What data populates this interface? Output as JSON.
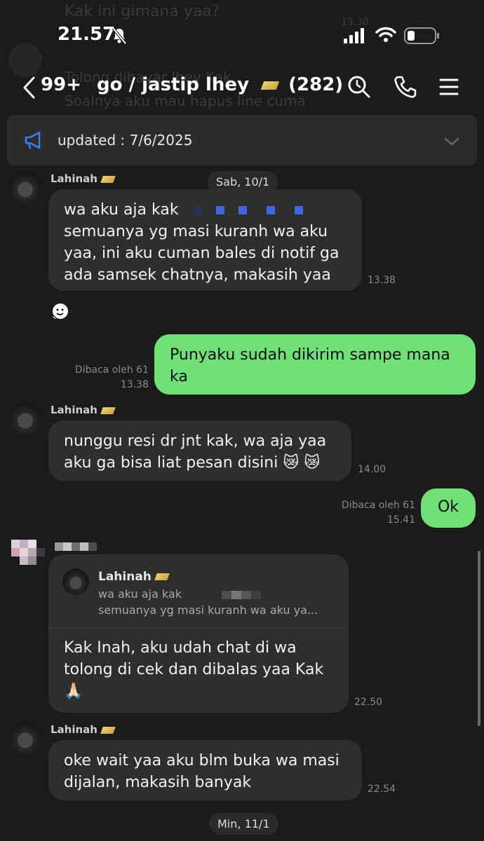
{
  "status": {
    "time": "21.57"
  },
  "nav": {
    "unread": "99+",
    "title": "go / jastip lhey",
    "members": "(282)"
  },
  "ghost": {
    "line1": "Kak ini gimana yaa?",
    "time1": "13.30",
    "line2": "Tolong dibayar lhey Kak",
    "line3": "Soalnya aku mau hapus line cuma"
  },
  "announcement": {
    "text": "updated : 7/6/2025"
  },
  "dates": {
    "sab": "Sab, 10/1",
    "min": "Min, 11/1"
  },
  "messages": {
    "m1": {
      "sender": "Lahinah",
      "lines": [
        "wa aku aja kak",
        "semuanya yg masi kuranh wa aku",
        "yaa, ini aku cuman bales di notif ga",
        "ada samsek chatnya, makasih yaa"
      ],
      "time": "13.38"
    },
    "m2": {
      "text": "Punyaku sudah dikirim sampe mana ka",
      "read": "Dibaca oleh 61",
      "time": "13.38"
    },
    "m3": {
      "sender": "Lahinah",
      "lines": [
        "nunggu resi dr jnt kak, wa aja yaa",
        "aku ga bisa liat pesan disini 😿 😿"
      ],
      "time": "14.00"
    },
    "m4": {
      "text": "Ok",
      "read": "Dibaca oleh 61",
      "time": "15.41"
    },
    "m5": {
      "quote_sender": "Lahinah",
      "quote_line1": "wa aku aja kak",
      "quote_line2": "semuanya yg masi kuranh wa aku ya...",
      "lines": [
        "Kak Inah, aku udah chat di wa",
        "tolong di cek dan dibalas yaa Kak",
        "🙏🏻"
      ],
      "time": "22.50"
    },
    "m6": {
      "sender": "Lahinah",
      "lines": [
        "oke wait yaa aku blm buka wa masi",
        "dijalan, makasih banyak"
      ],
      "time": "22.54"
    }
  },
  "colors": {
    "background": "#1b1b1b",
    "bubble_in": "#2e2e2e",
    "bubble_out": "#6fe177",
    "accent": "#3f7df0"
  }
}
